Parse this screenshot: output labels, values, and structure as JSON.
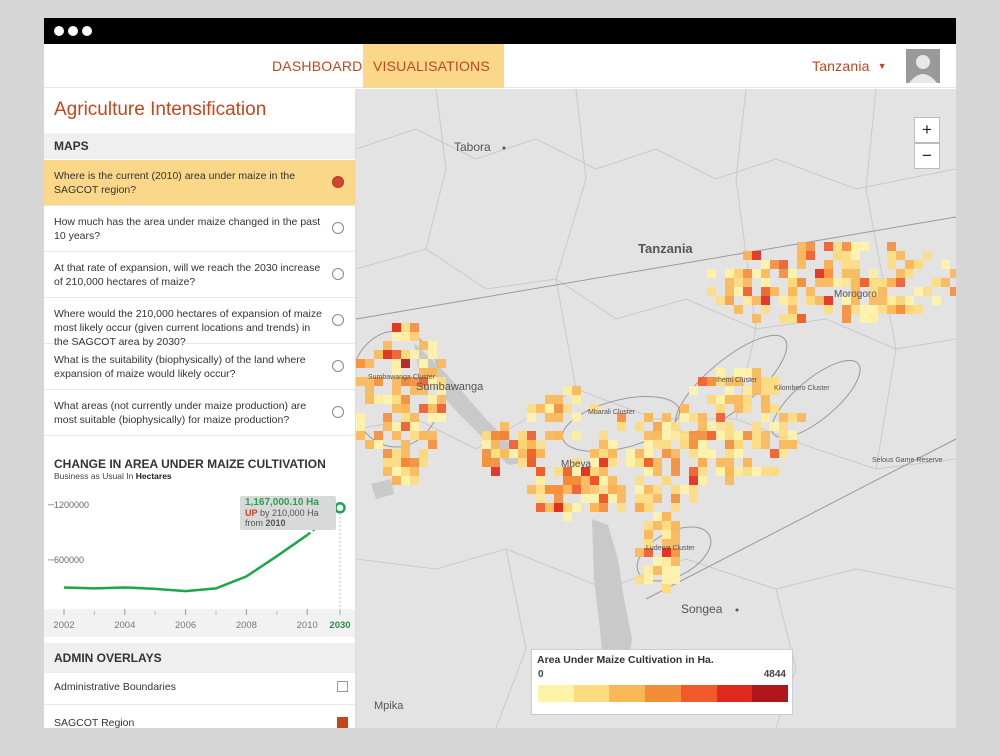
{
  "nav": {
    "dashboard": "DASHBOARD",
    "visualisations": "VISUALISATIONS",
    "country": "Tanzania"
  },
  "sidebar": {
    "title": "Agriculture Intensification",
    "maps_heading": "MAPS",
    "questions": [
      {
        "text": "Where is the current (2010) area under maize in the SAGCOT region?",
        "selected": true
      },
      {
        "text": "How much has the area under maize changed in the past 10 years?",
        "selected": false
      },
      {
        "text": "At that rate of expansion, will we reach the 2030 increase of 210,000 hectares of maize?",
        "selected": false
      },
      {
        "text": "Where would the 210,000 hectares of expansion of maize most likely occur (given current locations and trends) in the SAGCOT area by 2030?",
        "selected": false
      },
      {
        "text": "What is the suitability (biophysically) of the land where expansion of maize would likely occur?",
        "selected": false
      },
      {
        "text": "What areas (not currently under maize production) are most suitable (biophysically) for maize production?",
        "selected": false
      }
    ],
    "chart_heading": "CHANGE IN AREA UNDER MAIZE CULTIVATION",
    "chart_sub_prefix": "Business as Usual In",
    "chart_sub_unit": "Hectares",
    "overlays_heading": "ADMIN OVERLAYS",
    "overlays": [
      {
        "label": "Administrative Boundaries",
        "checked": false
      },
      {
        "label": "SAGCOT Region",
        "checked": true
      }
    ]
  },
  "tooltip": {
    "value": "1,167,000.10 Ha",
    "up": "UP",
    "by": "by 210,000 Ha",
    "from_label": "from",
    "from_year": "2010"
  },
  "chart_data": {
    "type": "line",
    "x": [
      2002,
      2003,
      2004,
      2005,
      2006,
      2007,
      2008,
      2009,
      2010,
      2030
    ],
    "x_ticks": [
      "2002",
      "2004",
      "2006",
      "2008",
      "2010",
      "2030"
    ],
    "y_ticks": [
      "1200000",
      "600000"
    ],
    "series": [
      {
        "values": [
          300000,
          290000,
          300000,
          285000,
          260000,
          290000,
          420000,
          640000,
          870000,
          1167000.1
        ]
      }
    ],
    "ylim": [
      0,
      1350000
    ],
    "colors": {
      "line": "#1aa64a",
      "highlight": "#2a8a4a"
    }
  },
  "map": {
    "zoom_in": "+",
    "zoom_out": "−",
    "labels": {
      "tabora": "Tabora",
      "tanzania": "Tanzania",
      "morogoro": "Morogoro",
      "sumbawanga": "Sumbawanga",
      "sumbawanga_cluster": "Sumbawanga Cluster",
      "mbarali_cluster": "Mbarali Cluster",
      "ihemi_cluster": "Ihemi Cluster",
      "kilombero_cluster": "Kilombero Cluster",
      "selous": "Selous Game Reserve",
      "mbeya": "Mbeya",
      "ludewa_cluster": "Ludewa Cluster",
      "songea": "Songea",
      "mpika": "Mpika"
    }
  },
  "legend": {
    "title": "Area Under Maize Cultivation in Ha.",
    "min": "0",
    "max": "4844",
    "colors": [
      "#fff3a8",
      "#fddc7f",
      "#f9b756",
      "#f48d3a",
      "#ef5a28",
      "#e0281c",
      "#b0151c"
    ]
  }
}
